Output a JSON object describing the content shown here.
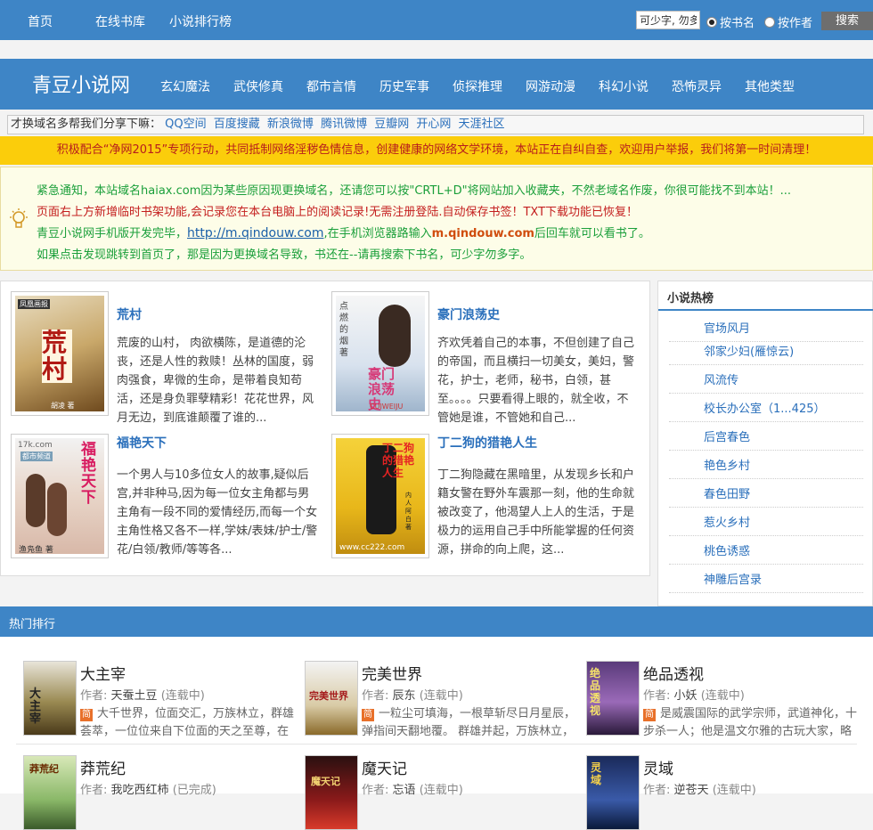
{
  "topnav": [
    "首页",
    "在线书库",
    "小说排行榜"
  ],
  "search": {
    "value": "可少字, 勿多",
    "radio1": "按书名",
    "radio2": "按作者",
    "button": "搜索"
  },
  "header": {
    "logo": "青豆小说网",
    "categories": [
      "玄幻魔法",
      "武侠修真",
      "都市言情",
      "历史军事",
      "侦探推理",
      "网游动漫",
      "科幻小说",
      "恐怖灵异",
      "其他类型"
    ]
  },
  "share": {
    "prefix": "才换域名多帮我们分享下嘛：",
    "links": [
      "QQ空间",
      "百度搜藏",
      "新浪微博",
      "腾讯微博",
      "豆瓣网",
      "开心网",
      "天涯社区"
    ]
  },
  "notice": "积极配合“净网2015”专项行动，共同抵制网络淫秽色情信息，创建健康的网络文学环境，本站正在自纠自查，欢迎用户举报，我们将第一时间清理！",
  "alerts": {
    "line1": "紧急通知，本站域名haiax.com因为某些原因现更换域名，还请您可以按\"CRTL+D\"将网站加入收藏夹，不然老域名作废，你很可能找不到本站！...",
    "line2": "页面右上方新增临时书架功能,会记录您在本台电脑上的阅读记录!无需注册登陆.自动保存书签！TXT下载功能已恢复！",
    "line3a": "青豆小说网手机版开发完毕，",
    "line3link": "http://m.qindouw.com",
    "line3b": ",在手机浏览器路输入",
    "line3c": "m.qindouw.com",
    "line3d": "后回车就可以看书了。",
    "line4": "如果点击发现跳转到首页了，那是因为更换域名导致，书还在--请再搜索下书名，可少字勿多字。"
  },
  "books": [
    {
      "title": "荒村",
      "desc": "荒废的山村， 肉欲横陈，是道德的沦丧，还是人性的救赎！丛林的国度，弱肉强食，卑微的生命，是带着良知苟活，还是身负罪孽精彩！花花世界，风月无边，到底谁颠覆了谁的..."
    },
    {
      "title": "豪门浪荡史",
      "desc": "齐欢凭着自己的本事，不但创建了自己的帝国，而且横扫一切美女，美妇，警花，护士，老师，秘书，白领，甚至。。。。只要看得上眼的，就全收，不管她是谁，不管她和自己..."
    },
    {
      "title": "福艳天下",
      "desc": "一个男人与10多位女人的故事,疑似后宫,并非种马,因为每一位女主角都与男主角有一段不同的爱情经历,而每一个女主角性格又各不一样,学妹/表妹/护士/警花/白领/教师/等等各..."
    },
    {
      "title": "丁二狗的猎艳人生",
      "desc": "丁二狗隐藏在黑暗里，从发现乡长和户籍女警在野外车震那一刻，他的生命就被改变了，他渴望人上人的生活，于是极力的运用自己手中所能掌握的任何资源，拼命的向上爬，这..."
    }
  ],
  "cover_text": {
    "b1_badge": "凤凰画报",
    "b1_big": "荒村",
    "b1_author": "胡凌 著",
    "b2_vert": "点燃的烟 著",
    "b2_big": "豪门浪荡史",
    "b2_sub": "CUIWEIJU",
    "b3_site": "17k.com",
    "b3_sub": "都市频道",
    "b3_big": "福艳天下",
    "b3_author": "渔凫鱼 著",
    "b4_big": "丁二狗的猎艳人生",
    "b4_author": "内人阿白 著",
    "b4_site": "www.cc222.com"
  },
  "hot": {
    "title": "小说热榜",
    "items": [
      "官场风月",
      "邻家少妇(雁惊云)",
      "风流传",
      "校长办公室（1...425）",
      "后宫春色",
      "艳色乡村",
      "春色田野",
      "惹火乡村",
      "桃色诱惑",
      "神雕后宫录"
    ]
  },
  "ranking": {
    "title": "热门排行",
    "author_label": "作者:",
    "jian": "简",
    "items": [
      {
        "title": "大主宰",
        "author": "天蚕土豆",
        "status": "(连载中)",
        "desc": "大千世界，位面交汇，万族林立，群雄荟萃，一位位来自下位面的天之至尊，在这无",
        "cover": "大主宰"
      },
      {
        "title": "完美世界",
        "author": "辰东",
        "status": "(连载中)",
        "desc": "一粒尘可填海，一根草斩尽日月星辰，弹指间天翻地覆。 群雄并起，万族林立，诸",
        "cover": "完美世界"
      },
      {
        "title": "绝品透视",
        "author": "小妖",
        "status": "(连载中)",
        "desc": "是威震国际的武学宗师，武道神化，十步杀一人；他是温文尔雅的古玩大家，略于鉴",
        "cover": "绝品透视"
      },
      {
        "title": "莽荒纪",
        "author": "我吃西红柿",
        "status": "(已完成)",
        "cover": "莽荒纪"
      },
      {
        "title": "魔天记",
        "author": "忘语",
        "status": "(连载中)",
        "cover": "魔天记"
      },
      {
        "title": "灵域",
        "author": "逆苍天",
        "status": "(连载中)",
        "cover": "灵域"
      }
    ]
  },
  "colors": {
    "blue": "#3e85c6",
    "yellow": "#fbcd0b",
    "red": "#b71d1d",
    "green": "#1a9f3a",
    "link": "#2a6fbb"
  }
}
